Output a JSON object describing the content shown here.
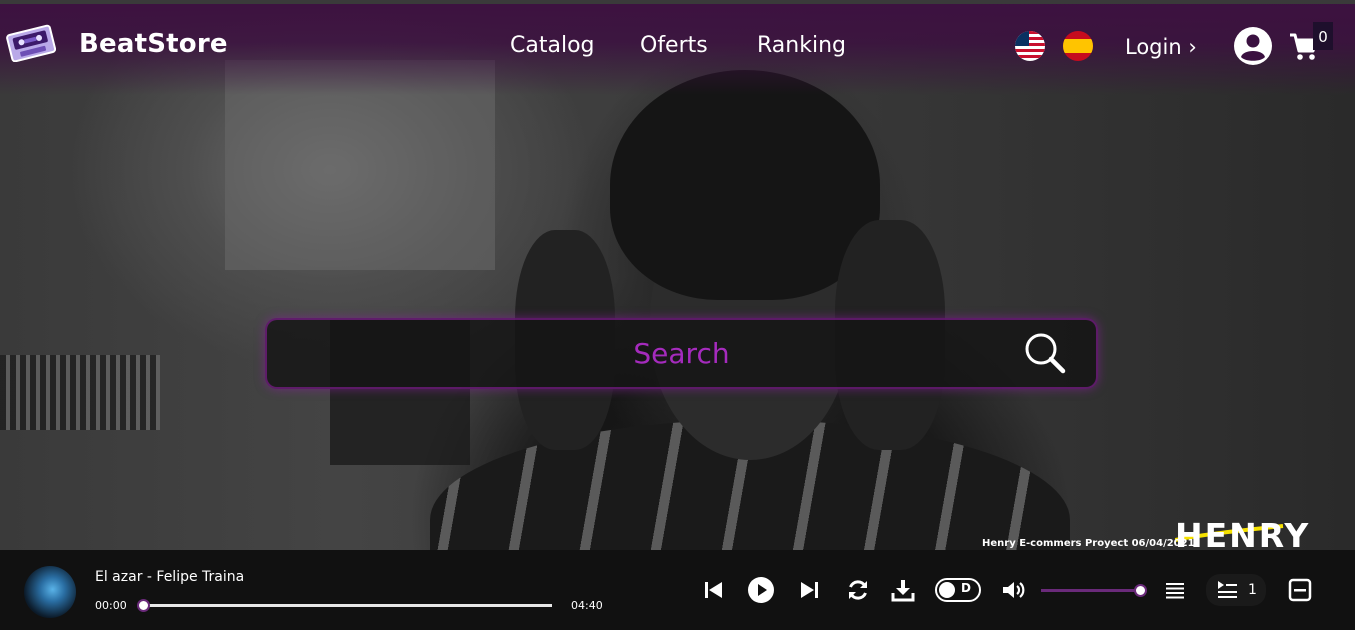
{
  "header": {
    "brand": "BeatStore",
    "nav": {
      "catalog": "Catalog",
      "oferts": "Oferts",
      "ranking": "Ranking"
    },
    "login": "Login ›",
    "cart_count": "0",
    "languages": [
      "en-US",
      "es"
    ]
  },
  "search": {
    "placeholder": "Search"
  },
  "watermark": {
    "logo": "HENRY",
    "caption": "Henry E-commers Proyect 06/04/2021"
  },
  "player": {
    "track_title": "El azar - Felipe Traina",
    "time_current": "00:00",
    "time_total": "04:40",
    "progress": 0.0,
    "volume": 1.0,
    "toggle_label": "D",
    "queue_count": "1"
  },
  "colors": {
    "accent": "#a52bbd",
    "header_bg": "#3d1140",
    "player_bg": "#111111"
  },
  "icons": [
    "cassette-logo-icon",
    "us-flag-icon",
    "spain-flag-icon",
    "user-icon",
    "cart-icon",
    "search-icon",
    "skip-previous-icon",
    "play-icon",
    "skip-next-icon",
    "repeat-icon",
    "download-icon",
    "volume-icon",
    "playlist-icon",
    "queue-icon",
    "minimize-icon"
  ]
}
